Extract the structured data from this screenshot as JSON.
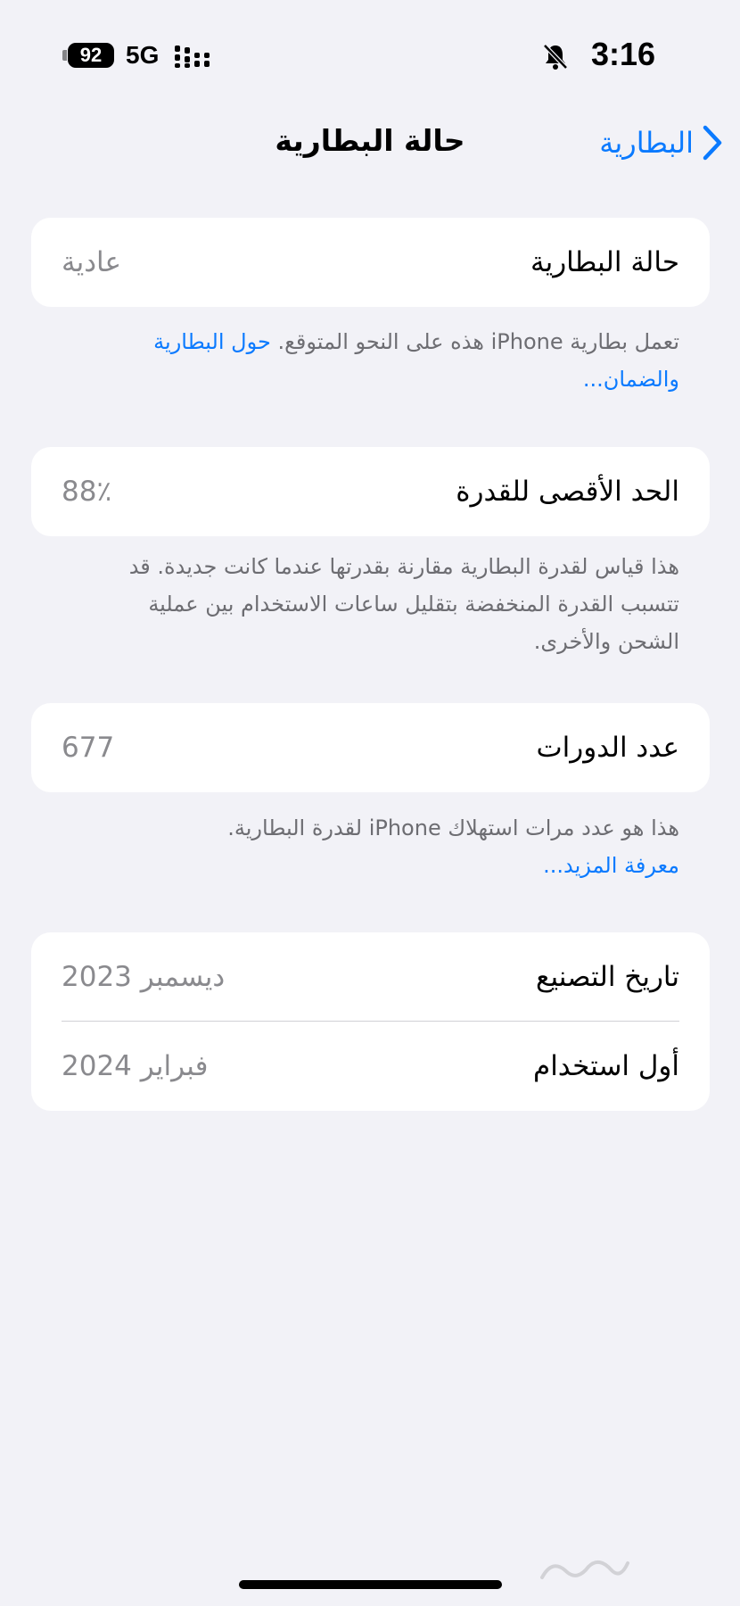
{
  "status_bar": {
    "time": "3:16",
    "battery_level": "92",
    "network": "5G",
    "signal_icon": "signal-bars-icon",
    "bell_icon": "bell-slash-icon"
  },
  "nav": {
    "title": "حالة البطارية",
    "back_label": "البطارية",
    "back_icon": "chevron-right-icon"
  },
  "battery_health": {
    "label": "حالة البطارية",
    "value": "عادية",
    "note": "تعمل بطارية iPhone هذه على النحو المتوقع.",
    "link": "حول البطارية والضمان..."
  },
  "maximum_capacity": {
    "label": "الحد الأقصى للقدرة",
    "value": "88٪",
    "note": "هذا قياس لقدرة البطارية مقارنة بقدرتها عندما كانت جديدة. قد تتسبب القدرة المنخفضة بتقليل ساعات الاستخدام بين عملية الشحن والأخرى."
  },
  "cycle_count": {
    "label": "عدد الدورات",
    "value": "677",
    "note": "هذا هو عدد مرات استهلاك iPhone لقدرة البطارية.",
    "link": "معرفة المزيد..."
  },
  "dates": {
    "manufacture_label": "تاريخ التصنيع",
    "manufacture_value": "ديسمبر 2023",
    "first_use_label": "أول استخدام",
    "first_use_value": "فبراير 2024"
  },
  "colors": {
    "accent": "#0a7aff",
    "background": "#f2f2f7",
    "secondary_text": "#8a8a8e"
  }
}
